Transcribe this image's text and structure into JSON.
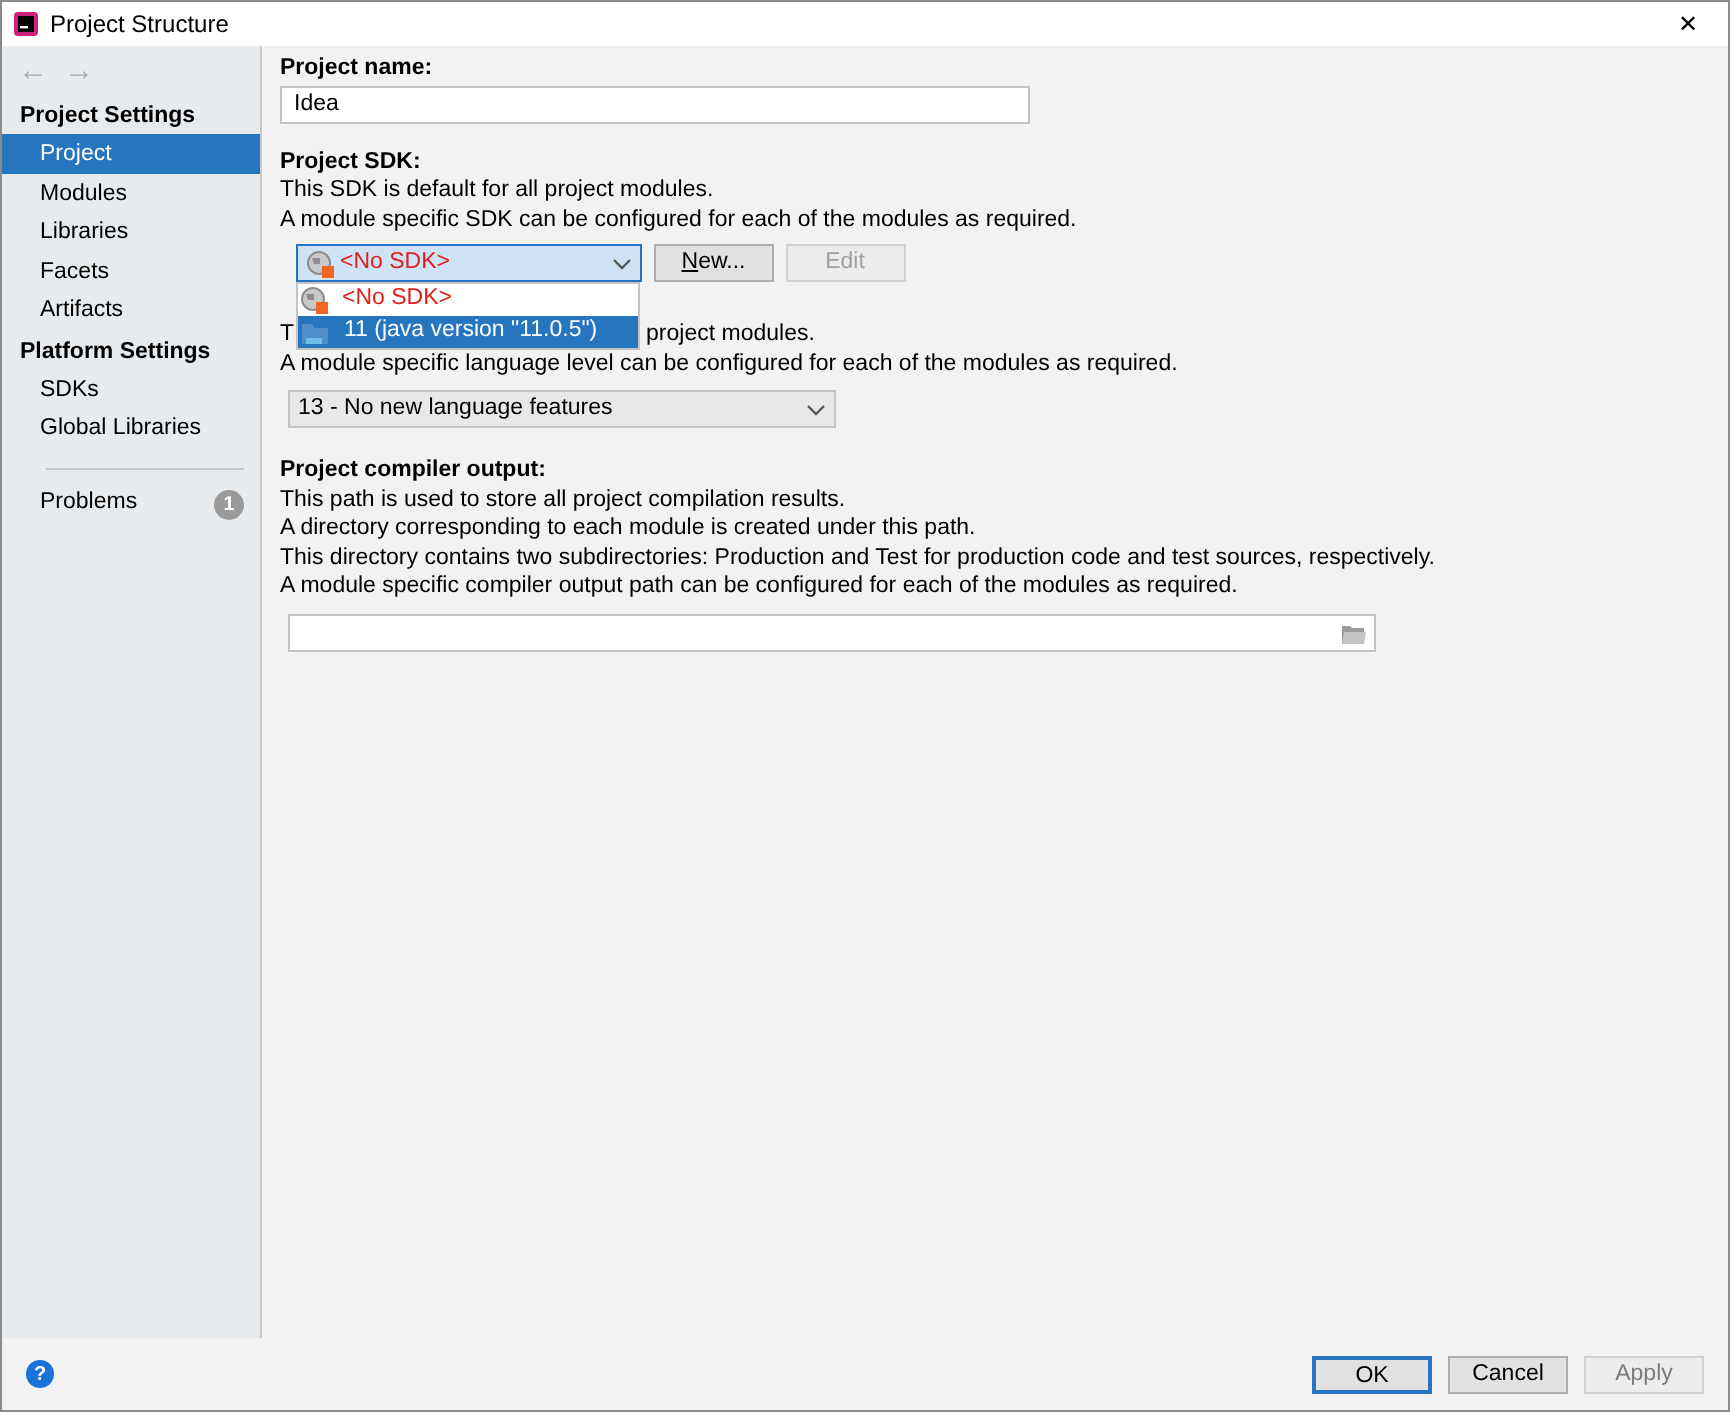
{
  "window": {
    "title": "Project Structure",
    "close": "✕"
  },
  "sidebar": {
    "nav": [
      {
        "label": "←",
        "disabled": true
      },
      {
        "label": "→",
        "disabled": true
      }
    ],
    "sections": [
      {
        "heading": "Project Settings",
        "items": [
          {
            "label": "Project",
            "selected": true
          },
          {
            "label": "Modules",
            "selected": false
          },
          {
            "label": "Libraries",
            "selected": false
          },
          {
            "label": "Facets",
            "selected": false
          },
          {
            "label": "Artifacts",
            "selected": false
          }
        ]
      },
      {
        "heading": "Platform Settings",
        "items": [
          {
            "label": "SDKs",
            "selected": false
          },
          {
            "label": "Global Libraries",
            "selected": false
          }
        ]
      }
    ],
    "problems": {
      "label": "Problems",
      "count": "1"
    }
  },
  "project_name": {
    "label": "Project name:",
    "value": "Idea"
  },
  "project_sdk": {
    "label": "Project SDK:",
    "lines": [
      "This SDK is default for all project modules.",
      "A module specific SDK can be configured for each of the modules as required."
    ],
    "dropdown": {
      "value": "<No SDK>",
      "kind": "none",
      "expanded": true
    },
    "buttons": [
      {
        "label": "New...",
        "mnemonic": true,
        "disabled": false
      },
      {
        "label": "Edit",
        "mnemonic": false,
        "disabled": true
      }
    ],
    "options": [
      {
        "label": "<No SDK>",
        "kind": "none",
        "selected": false
      },
      {
        "label": "11 (java version \"11.0.5\")",
        "kind": "jdk",
        "selected": true
      }
    ]
  },
  "language_level": {
    "line_start": "T",
    "line_end": "project modules.",
    "line_2": "A module specific language level can be configured for each of the modules as required.",
    "dropdown": {
      "value": "13 - No new language features"
    }
  },
  "compiler_output": {
    "label": "Project compiler output:",
    "lines": [
      "This path is used to store all project compilation results.",
      "A directory corresponding to each module is created under this path.",
      "This directory contains two subdirectories: Production and Test for production code and test sources, respectively.",
      "A module specific compiler output path can be configured for each of the modules as required."
    ]
  },
  "footer": {
    "help": "?",
    "buttons": [
      {
        "label": "OK",
        "kind": "default",
        "disabled": false
      },
      {
        "label": "Cancel",
        "kind": "normal",
        "disabled": false
      },
      {
        "label": "Apply",
        "kind": "normal",
        "disabled": true
      }
    ]
  }
}
